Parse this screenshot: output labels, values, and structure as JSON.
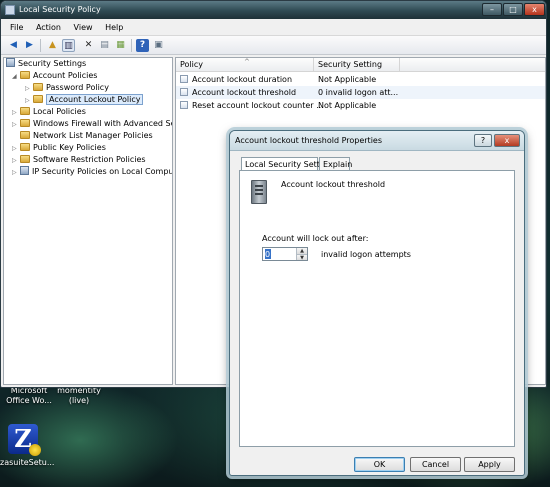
{
  "desktop": {
    "icons": [
      {
        "line1": "Microsoft",
        "line2": "Office Wo...",
        "icon": "document-icon"
      },
      {
        "line1": "momentity",
        "line2": "(live)",
        "icon": "app-icon"
      }
    ],
    "zasuite_label": "zasuiteSetu...",
    "zasuite_glyph": "Z"
  },
  "window": {
    "title": "Local Security Policy",
    "controls": [
      "–",
      "□",
      "x"
    ],
    "menu": [
      "File",
      "Action",
      "View",
      "Help"
    ]
  },
  "toolbar": {
    "icons": [
      "back-arrow-icon",
      "forward-arrow-icon",
      "up-folder-icon",
      "show-hide-tree-icon",
      "delete-icon",
      "properties-icon",
      "export-list-icon",
      "help-icon",
      "mmc-console-icon"
    ]
  },
  "tree": {
    "items": [
      {
        "label": "Security Settings"
      },
      {
        "label": "Account Policies"
      },
      {
        "label": "Password Policy"
      },
      {
        "label": "Account Lockout Policy"
      },
      {
        "label": "Local Policies"
      },
      {
        "label": "Windows Firewall with Advanced Secu"
      },
      {
        "label": "Network List Manager Policies"
      },
      {
        "label": "Public Key Policies"
      },
      {
        "label": "Software Restriction Policies"
      },
      {
        "label": "IP Security Policies on Local Compute"
      }
    ]
  },
  "list": {
    "columns": [
      "Policy",
      "Security Setting"
    ],
    "rows": [
      {
        "policy": "Account lockout duration",
        "setting": "Not Applicable"
      },
      {
        "policy": "Account lockout threshold",
        "setting": "0 invalid logon att..."
      },
      {
        "policy": "Reset account lockout counter ...",
        "setting": "Not Applicable"
      }
    ]
  },
  "dialog": {
    "title": "Account lockout threshold Properties",
    "help_label": "?",
    "close_label": "x",
    "tabs": [
      "Local Security Setting",
      "Explain"
    ],
    "policy_title": "Account lockout threshold",
    "lockout_label": "Account will lock out after:",
    "threshold_value": "0",
    "unit_label": "invalid logon attempts",
    "ok_label": "OK",
    "cancel_label": "Cancel",
    "apply_label": "Apply"
  }
}
